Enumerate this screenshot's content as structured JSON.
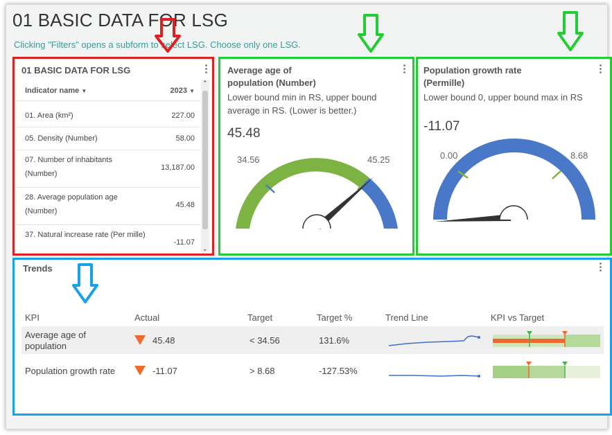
{
  "page": {
    "title": "01 BASIC DATA FOR LSG",
    "subtitle": "Clicking \"Filters\" opens a subform to select LSG. Choose only one LSG."
  },
  "table_panel": {
    "title": "01 BASIC DATA FOR LSG",
    "col_name": "Indicator name",
    "col_year": "2023",
    "rows": [
      {
        "name": "01. Area (km²)",
        "value": "227.00"
      },
      {
        "name": "05. Density (Number)",
        "value": "58.00"
      },
      {
        "name": "07. Number of inhabitants (Number)",
        "value": "13,187.00"
      },
      {
        "name": "28. Average population age (Number)",
        "value": "45.48"
      },
      {
        "name": "37. Natural increase rate (Per mille)",
        "value": "-11.07"
      }
    ]
  },
  "gauge_age": {
    "title": "Average age of population (Number)",
    "description": "Lower bound min in RS, upper bound average in RS. (Lower is better.)",
    "value": "45.48",
    "min_label": "34.56",
    "max_label": "45.25",
    "range": {
      "min": 34.56,
      "max": 45.25
    },
    "needle_value": 45.48,
    "colors": {
      "good": "#7cb342",
      "bad": "#4a78c8"
    }
  },
  "gauge_growth": {
    "title": "Population growth rate (Permille)",
    "description": "Lower bound 0, upper bound max in RS",
    "value": "-11.07",
    "min_label": "0.00",
    "max_label": "8.68",
    "range": {
      "min": 0,
      "max": 8.68
    },
    "needle_value": -11.07,
    "colors": {
      "main": "#4a78c8"
    }
  },
  "trends": {
    "title": "Trends",
    "headers": {
      "kpi": "KPI",
      "actual": "Actual",
      "target": "Target",
      "target_pct": "Target %",
      "trend": "Trend Line",
      "kpi_vs_target": "KPI vs Target"
    },
    "rows": [
      {
        "kpi": "Average age of population",
        "actual": "45.48",
        "target": "< 34.56",
        "target_pct": "131.6%",
        "status": "down"
      },
      {
        "kpi": "Population growth rate",
        "actual": "-11.07",
        "target": "> 8.68",
        "target_pct": "-127.53%",
        "status": "down"
      }
    ]
  },
  "colors": {
    "red_frame": "#e02020",
    "green_frame": "#22cc33",
    "blue_frame": "#18a0e8",
    "arrow_down": "#ee6a2c"
  }
}
